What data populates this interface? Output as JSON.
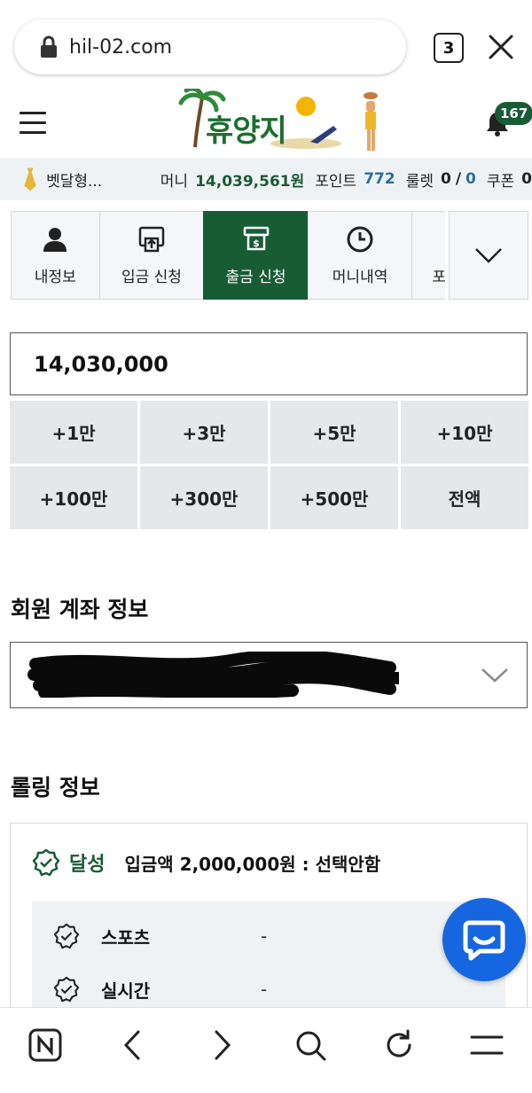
{
  "browser": {
    "url": "hil-02.com",
    "tab_count": "3"
  },
  "header": {
    "logo_text": "휴양지",
    "notification_count": "167"
  },
  "status": {
    "username": "벳달형...",
    "money_label": "머니",
    "money_value": "14,039,561원",
    "point_label": "포인트",
    "point_value": "772",
    "roulette_label": "룰렛",
    "roulette_used": "0",
    "roulette_sep": "/",
    "roulette_total": "0",
    "coupon_label": "쿠폰",
    "coupon_value": "0"
  },
  "menu": {
    "items": [
      {
        "label": "내정보",
        "icon": "user-icon"
      },
      {
        "label": "입금 신청",
        "icon": "deposit-icon"
      },
      {
        "label": "출금 신청",
        "icon": "withdraw-icon",
        "active": true
      },
      {
        "label": "머니내역",
        "icon": "clock-icon"
      },
      {
        "label": "포"
      }
    ]
  },
  "withdraw": {
    "amount": "14,030,000",
    "quick_buttons": [
      "+1만",
      "+3만",
      "+5만",
      "+10만",
      "+100만",
      "+300만",
      "+500만",
      "전액"
    ]
  },
  "account": {
    "title": "회원 계좌 정보"
  },
  "rolling": {
    "title": "롤링 정보",
    "status": "달성",
    "description": "입금액 2,000,000원 : 선택안함",
    "rows": [
      {
        "name": "스포츠",
        "value": "-"
      },
      {
        "name": "실시간",
        "value": "-"
      }
    ]
  },
  "colors": {
    "primary_green": "#185c36",
    "chat_blue": "#1566e0"
  }
}
